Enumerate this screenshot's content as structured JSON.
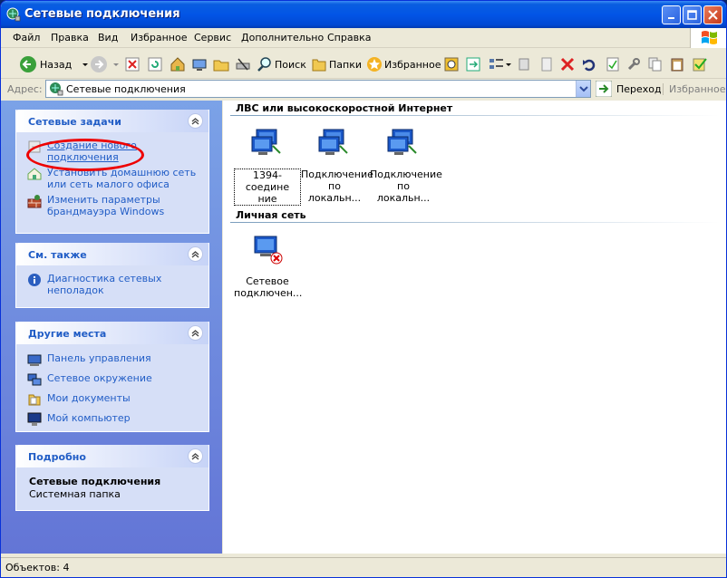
{
  "window": {
    "title": "Сетевые подключения"
  },
  "menu": [
    "Файл",
    "Правка",
    "Вид",
    "Избранное",
    "Сервис",
    "Дополнительно",
    "Справка"
  ],
  "toolbar": {
    "back": "Назад",
    "search": "Поиск",
    "folders": "Папки",
    "favorites": "Избранное"
  },
  "address": {
    "label": "Адрес:",
    "value": "Сетевые подключения",
    "go": "Переход",
    "fav_tab": "Избранное"
  },
  "sidebar": {
    "network_tasks": {
      "title": "Сетевые задачи",
      "items": [
        "Создание нового подключения",
        "Установить домашнюю сеть или сеть малого офиса",
        "Изменить параметры брандмауэра Windows"
      ]
    },
    "see_also": {
      "title": "См. также",
      "items": [
        "Диагностика сетевых неполадок"
      ]
    },
    "other_places": {
      "title": "Другие места",
      "items": [
        "Панель управления",
        "Сетевое окружение",
        "Мои документы",
        "Мой компьютер"
      ]
    },
    "details": {
      "title": "Подробно",
      "name": "Сетевые подключения",
      "type": "Системная папка"
    }
  },
  "groups": [
    {
      "title": "ЛВС или высокоскоростной Интернет",
      "items": [
        {
          "line1": "1394-соедине",
          "line2": "ние"
        },
        {
          "line1": "Подключение",
          "line2": "по локальн..."
        },
        {
          "line1": "Подключение",
          "line2": "по локальн..."
        }
      ]
    },
    {
      "title": "Личная сеть",
      "items": [
        {
          "line1": "Сетевое",
          "line2": "подключен..."
        }
      ]
    }
  ],
  "status": {
    "text": "Объектов: 4"
  },
  "colors": {
    "title_bar": "#0255e6",
    "link": "#215dc6",
    "task_pane": "#6f8fe0",
    "annotation": "#ee0000"
  }
}
